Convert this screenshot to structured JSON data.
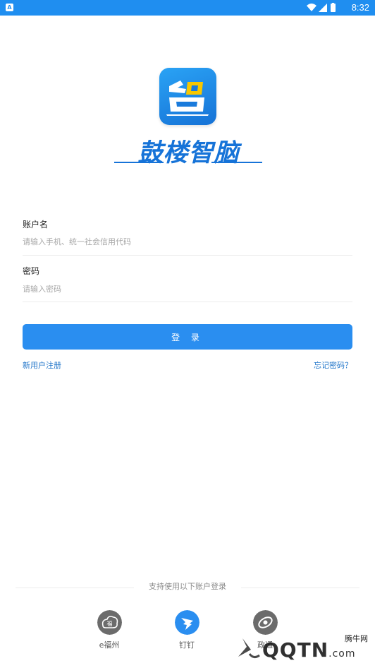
{
  "status_bar": {
    "notification_icon": "A",
    "time": "8:32",
    "icons": [
      "wifi-icon",
      "signal-icon",
      "battery-icon"
    ]
  },
  "app": {
    "name": "鼓楼智脑",
    "logo_icon": "zhi-logo-icon"
  },
  "form": {
    "account_label": "账户名",
    "account_placeholder": "请输入手机、统一社会信用代码",
    "password_label": "密码",
    "password_placeholder": "请输入密码",
    "login_button": "登 录",
    "register_link": "新用户注册",
    "forgot_link": "忘记密码？"
  },
  "third_party": {
    "title": "支持使用以下账户登录",
    "items": [
      {
        "label": "e福州",
        "icon": "efuzhou-icon",
        "color": "#6b6b6b"
      },
      {
        "label": "钉钉",
        "icon": "dingtalk-icon",
        "color": "#2a8ef0"
      },
      {
        "label": "政通",
        "icon": "zhengtong-icon",
        "color": "#6b6b6b"
      }
    ]
  },
  "colors": {
    "accent": "#2a8ef0",
    "status_bar": "#1f8ef0",
    "link": "#1f74c9"
  },
  "watermark": {
    "site_text": "QQTN",
    "domain": ".com",
    "brand": "腾牛网"
  }
}
